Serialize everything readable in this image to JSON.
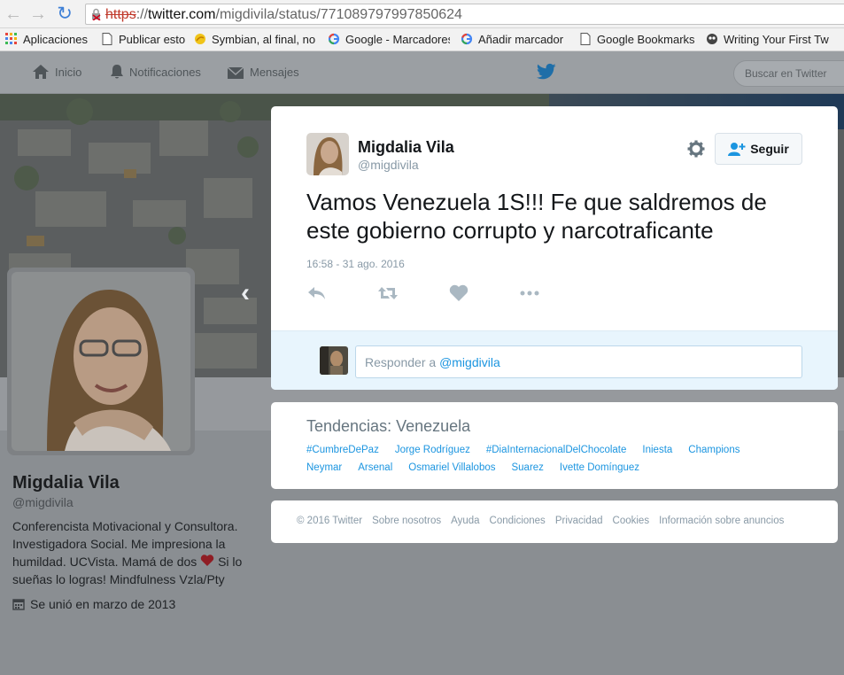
{
  "browser": {
    "url_scheme": "https",
    "url_sep": "://",
    "url_host": "twitter.com",
    "url_path": "/migdivila/status/771089797997850624",
    "bookmarks": [
      {
        "label": "Aplicaciones",
        "icon": "apps-grid-icon"
      },
      {
        "label": "Publicar esto",
        "icon": "page-icon"
      },
      {
        "label": "Symbian, al final, no",
        "icon": "symbian-icon"
      },
      {
        "label": "Google - Marcadores",
        "icon": "google-icon"
      },
      {
        "label": "Añadir marcador",
        "icon": "google-icon"
      },
      {
        "label": "Google Bookmarks",
        "icon": "page-icon"
      },
      {
        "label": "Writing Your First Tw",
        "icon": "owl-icon"
      }
    ]
  },
  "nav": {
    "home": "Inicio",
    "notifications": "Notificaciones",
    "messages": "Mensajes",
    "search_placeholder": "Buscar en Twitter"
  },
  "profile": {
    "name": "Migdalia Vila",
    "handle": "@migdivila",
    "bio_1": "Conferencista Motivacional y Consultora. Investigadora Social. Me impresiona la humildad. UCVista. Mamá de dos",
    "bio_2": "Si lo sueñas lo logras! Mindfulness Vzla/Pty",
    "joined": "Se unió en marzo de 2013"
  },
  "tweet": {
    "name": "Migdalia Vila",
    "handle": "@migdivila",
    "follow_label": "Seguir",
    "text": "Vamos Venezuela 1S!!! Fe que saldremos de este gobierno corrupto y narcotraficante",
    "timestamp": "16:58 - 31 ago. 2016",
    "reply_prefix": "Responder a ",
    "reply_mention": "@migdivila"
  },
  "trends": {
    "title": "Tendencias: Venezuela",
    "row1": [
      "#CumbreDePaz",
      "Jorge Rodríguez",
      "#DiaInternacionalDelChocolate",
      "Iniesta",
      "Champions"
    ],
    "row2": [
      "Neymar",
      "Arsenal",
      "Osmariel Villalobos",
      "Suarez",
      "Ivette Domínguez"
    ]
  },
  "footer": {
    "links": [
      "© 2016 Twitter",
      "Sobre nosotros",
      "Ayuda",
      "Condiciones",
      "Privacidad",
      "Cookies",
      "Información sobre anuncios"
    ]
  },
  "colors": {
    "link": "#1b95e0",
    "follow_icon": "#1b95e0",
    "heart": "#e0245e"
  }
}
